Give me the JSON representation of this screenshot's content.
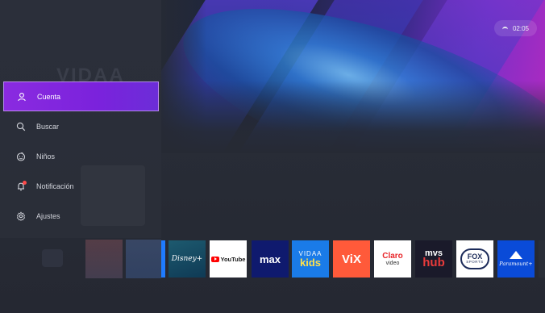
{
  "status": {
    "time": "02:05",
    "wifi_icon": "wifi-icon"
  },
  "background": {
    "ghost_logo": "VIDAA",
    "ghost_text": ""
  },
  "menu": {
    "items": [
      {
        "id": "cuenta",
        "label": "Cuenta",
        "icon": "user-icon",
        "active": true
      },
      {
        "id": "buscar",
        "label": "Buscar",
        "icon": "search-icon",
        "active": false
      },
      {
        "id": "ninos",
        "label": "Niños",
        "icon": "kids-face-icon",
        "active": false
      },
      {
        "id": "notificacion",
        "label": "Notificación",
        "icon": "bell-icon",
        "active": false,
        "badge": true
      },
      {
        "id": "ajustes",
        "label": "Ajustes",
        "icon": "gear-icon",
        "active": false
      }
    ]
  },
  "apps": {
    "disney": "Disney+",
    "youtube": "YouTube",
    "max": "max",
    "vidaa_kids_1": "VIDAA",
    "vidaa_kids_2": "kids",
    "vix": "ViX",
    "claro_1": "Claro",
    "claro_2": "video",
    "mvs_1": "mvs",
    "mvs_2": "hub",
    "fox_1": "FOX",
    "fox_2": "SPORTS",
    "paramount": "Paramount+"
  },
  "colors": {
    "accent": "#8a2be0",
    "background": "#262a34"
  }
}
